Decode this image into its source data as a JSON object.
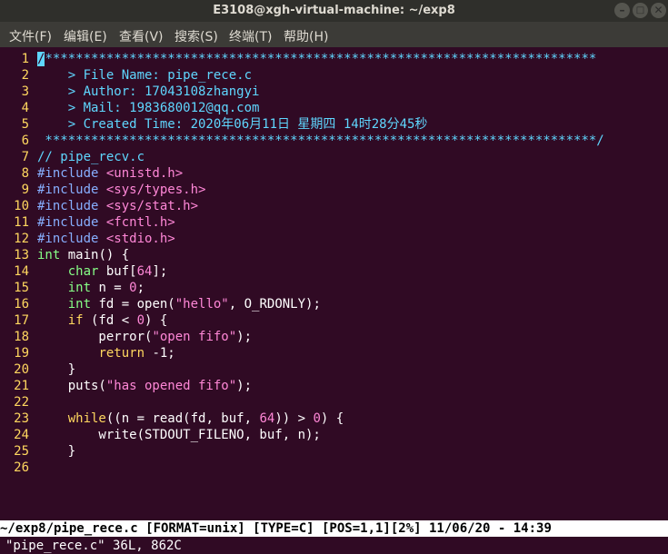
{
  "window": {
    "title": "E3108@xgh-virtual-machine: ~/exp8"
  },
  "window_controls": {
    "minimize": "–",
    "maximize": "□",
    "close": "✕"
  },
  "menubar": {
    "items": [
      {
        "label": "文件(F)"
      },
      {
        "label": "编辑(E)"
      },
      {
        "label": "查看(V)"
      },
      {
        "label": "搜索(S)"
      },
      {
        "label": "终端(T)"
      },
      {
        "label": "帮助(H)"
      }
    ]
  },
  "editor": {
    "lines": [
      {
        "n": "1",
        "parts": [
          {
            "c": "cursor",
            "t": "/"
          },
          {
            "c": "cm",
            "t": "************************************************************************"
          }
        ]
      },
      {
        "n": "2",
        "parts": [
          {
            "c": "cm",
            "t": "    > File Name: pipe_rece.c"
          }
        ]
      },
      {
        "n": "3",
        "parts": [
          {
            "c": "cm",
            "t": "    > Author: 17043108zhangyi"
          }
        ]
      },
      {
        "n": "4",
        "parts": [
          {
            "c": "cm",
            "t": "    > Mail: 1983680012@qq.com"
          }
        ]
      },
      {
        "n": "5",
        "parts": [
          {
            "c": "cm",
            "t": "    > Created Time: 2020年06月11日 星期四 14时28分45秒"
          }
        ]
      },
      {
        "n": "6",
        "parts": [
          {
            "c": "cm",
            "t": " ************************************************************************/"
          }
        ]
      },
      {
        "n": "7",
        "parts": [
          {
            "c": "cm",
            "t": "// pipe_recv.c"
          }
        ]
      },
      {
        "n": "8",
        "parts": [
          {
            "c": "pp",
            "t": "#include "
          },
          {
            "c": "st",
            "t": "<unistd.h>"
          }
        ]
      },
      {
        "n": "9",
        "parts": [
          {
            "c": "pp",
            "t": "#include "
          },
          {
            "c": "st",
            "t": "<sys/types.h>"
          }
        ]
      },
      {
        "n": "10",
        "parts": [
          {
            "c": "pp",
            "t": "#include "
          },
          {
            "c": "st",
            "t": "<sys/stat.h>"
          }
        ]
      },
      {
        "n": "11",
        "parts": [
          {
            "c": "pp",
            "t": "#include "
          },
          {
            "c": "st",
            "t": "<fcntl.h>"
          }
        ]
      },
      {
        "n": "12",
        "parts": [
          {
            "c": "pp",
            "t": "#include "
          },
          {
            "c": "st",
            "t": "<stdio.h>"
          }
        ]
      },
      {
        "n": "13",
        "parts": [
          {
            "c": "ty",
            "t": "int"
          },
          {
            "c": "",
            "t": " main() {"
          }
        ]
      },
      {
        "n": "14",
        "parts": [
          {
            "c": "",
            "t": "    "
          },
          {
            "c": "ty",
            "t": "char"
          },
          {
            "c": "",
            "t": " buf["
          },
          {
            "c": "num",
            "t": "64"
          },
          {
            "c": "",
            "t": "];"
          }
        ]
      },
      {
        "n": "15",
        "parts": [
          {
            "c": "",
            "t": "    "
          },
          {
            "c": "ty",
            "t": "int"
          },
          {
            "c": "",
            "t": " n = "
          },
          {
            "c": "num",
            "t": "0"
          },
          {
            "c": "",
            "t": ";"
          }
        ]
      },
      {
        "n": "16",
        "parts": [
          {
            "c": "",
            "t": "    "
          },
          {
            "c": "ty",
            "t": "int"
          },
          {
            "c": "",
            "t": " fd = open("
          },
          {
            "c": "st",
            "t": "\"hello\""
          },
          {
            "c": "",
            "t": ", O_RDONLY);"
          }
        ]
      },
      {
        "n": "17",
        "parts": [
          {
            "c": "",
            "t": "    "
          },
          {
            "c": "kw",
            "t": "if"
          },
          {
            "c": "",
            "t": " (fd < "
          },
          {
            "c": "num",
            "t": "0"
          },
          {
            "c": "",
            "t": ") {"
          }
        ]
      },
      {
        "n": "18",
        "parts": [
          {
            "c": "",
            "t": "        perror("
          },
          {
            "c": "st",
            "t": "\"open fifo\""
          },
          {
            "c": "",
            "t": ");"
          }
        ]
      },
      {
        "n": "19",
        "parts": [
          {
            "c": "",
            "t": "        "
          },
          {
            "c": "kw",
            "t": "return"
          },
          {
            "c": "",
            "t": " -1;"
          }
        ]
      },
      {
        "n": "20",
        "parts": [
          {
            "c": "",
            "t": "    }"
          }
        ]
      },
      {
        "n": "21",
        "parts": [
          {
            "c": "",
            "t": "    puts("
          },
          {
            "c": "st",
            "t": "\"has opened fifo\""
          },
          {
            "c": "",
            "t": ");"
          }
        ]
      },
      {
        "n": "22",
        "parts": []
      },
      {
        "n": "23",
        "parts": [
          {
            "c": "",
            "t": "    "
          },
          {
            "c": "kw",
            "t": "while"
          },
          {
            "c": "",
            "t": "((n = read(fd, buf, "
          },
          {
            "c": "num",
            "t": "64"
          },
          {
            "c": "",
            "t": ")) > "
          },
          {
            "c": "num",
            "t": "0"
          },
          {
            "c": "",
            "t": ") {"
          }
        ]
      },
      {
        "n": "24",
        "parts": [
          {
            "c": "",
            "t": "        write(STDOUT_FILENO, buf, n);"
          }
        ]
      },
      {
        "n": "25",
        "parts": [
          {
            "c": "",
            "t": "    }"
          }
        ]
      },
      {
        "n": "26",
        "parts": []
      }
    ]
  },
  "statusline": {
    "text": "~/exp8/pipe_rece.c [FORMAT=unix] [TYPE=C] [POS=1,1][2%] 11/06/20 - 14:39"
  },
  "message": {
    "text": "\"pipe_rece.c\" 36L, 862C"
  }
}
